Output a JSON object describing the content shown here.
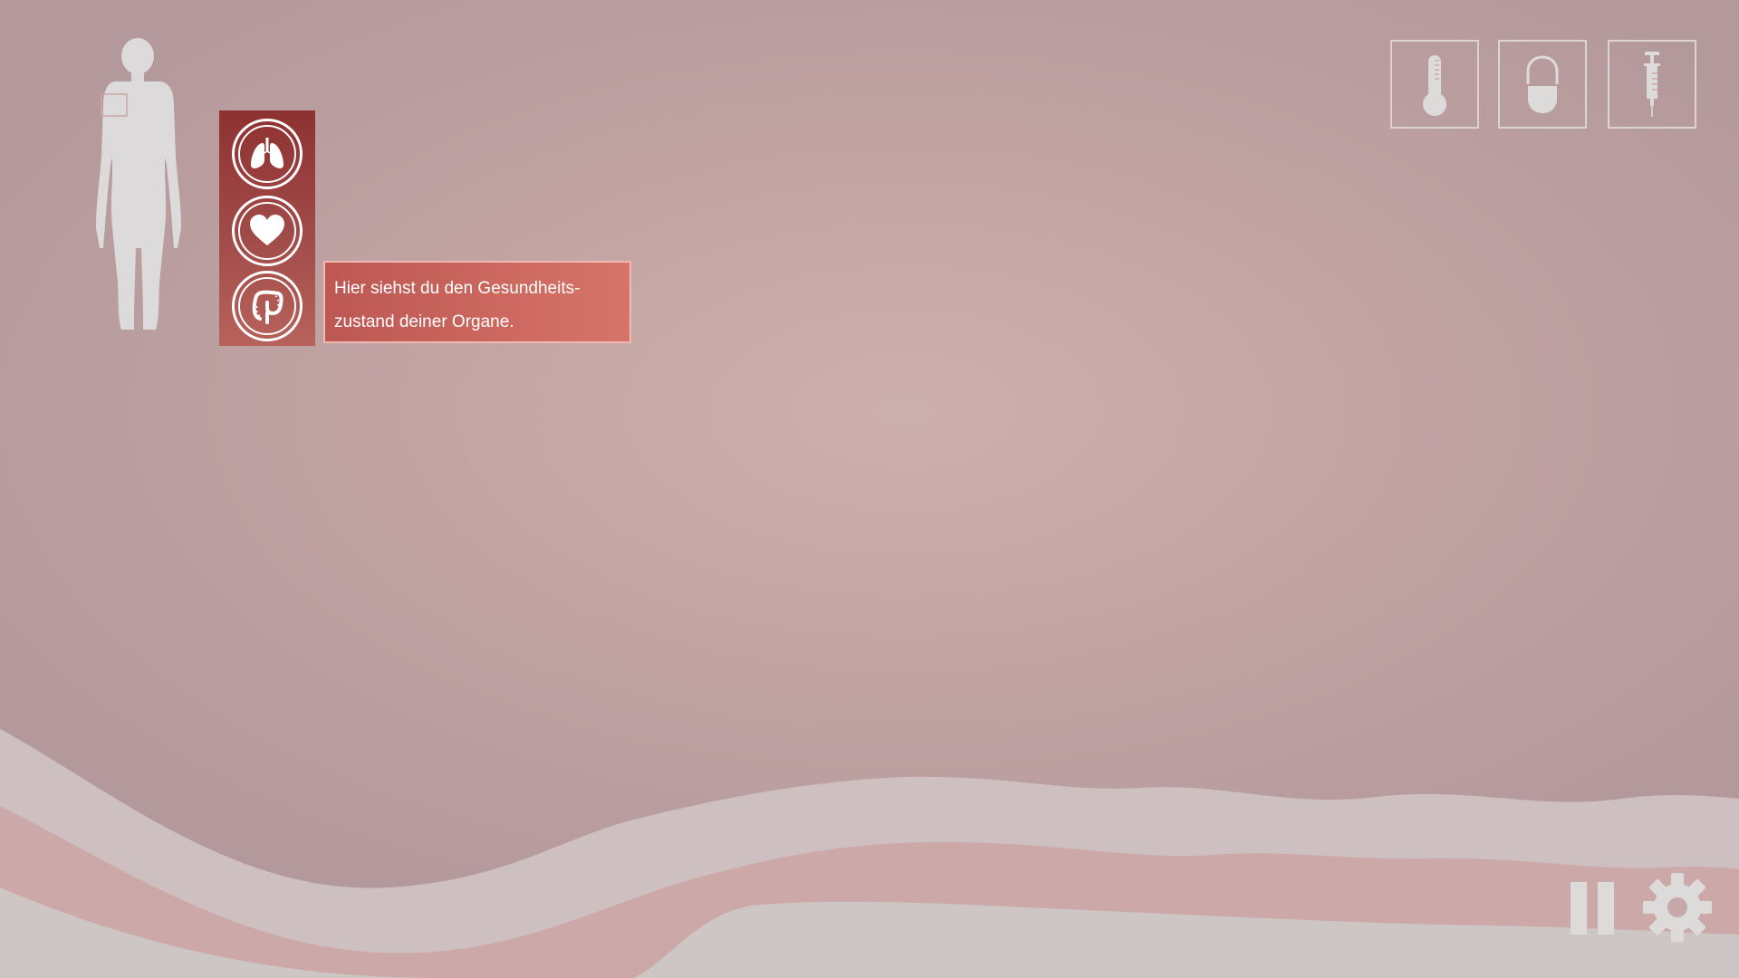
{
  "tutorial": {
    "line1": "Hier siehst du den Gesundheits-",
    "line2": "zustand deiner Organe."
  },
  "organs": [
    "lungs-icon",
    "heart-icon",
    "intestine-icon"
  ],
  "tools": [
    "thermometer-icon",
    "pill-icon",
    "syringe-icon"
  ],
  "controls": [
    "pause-icon",
    "gear-icon"
  ],
  "colors": {
    "background": "#c2a4a3",
    "organ_panel": "#9a3c3a",
    "tooltip": "#c9625c",
    "icon_light": "#dddada"
  }
}
